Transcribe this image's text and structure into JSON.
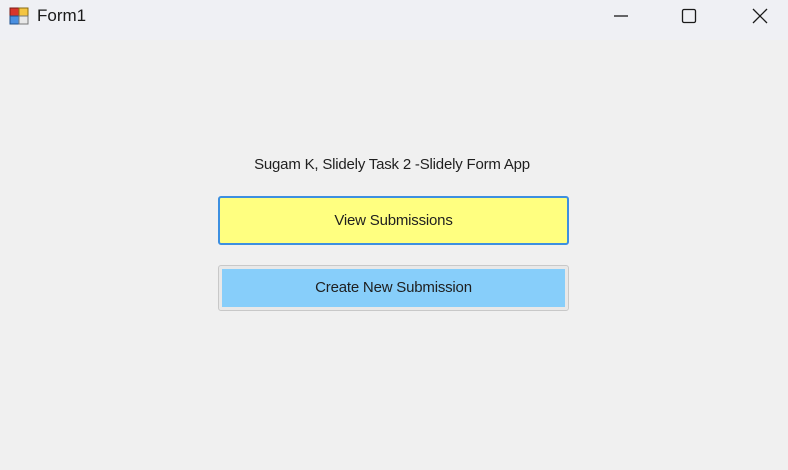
{
  "window": {
    "title": "Form1",
    "icon": "form-app-icon",
    "controls": {
      "minimize": "minimize-icon",
      "maximize": "maximize-icon",
      "close": "close-icon"
    }
  },
  "form": {
    "caption": "Sugam K, Slidely Task 2 -Slidely Form App",
    "view_button_label": "View Submissions",
    "create_button_label": "Create New Submission"
  },
  "colors": {
    "background": "#f0f0f0",
    "view_button": "#ffff80",
    "view_button_border": "#3d8fe0",
    "create_button": "#87cefa"
  }
}
